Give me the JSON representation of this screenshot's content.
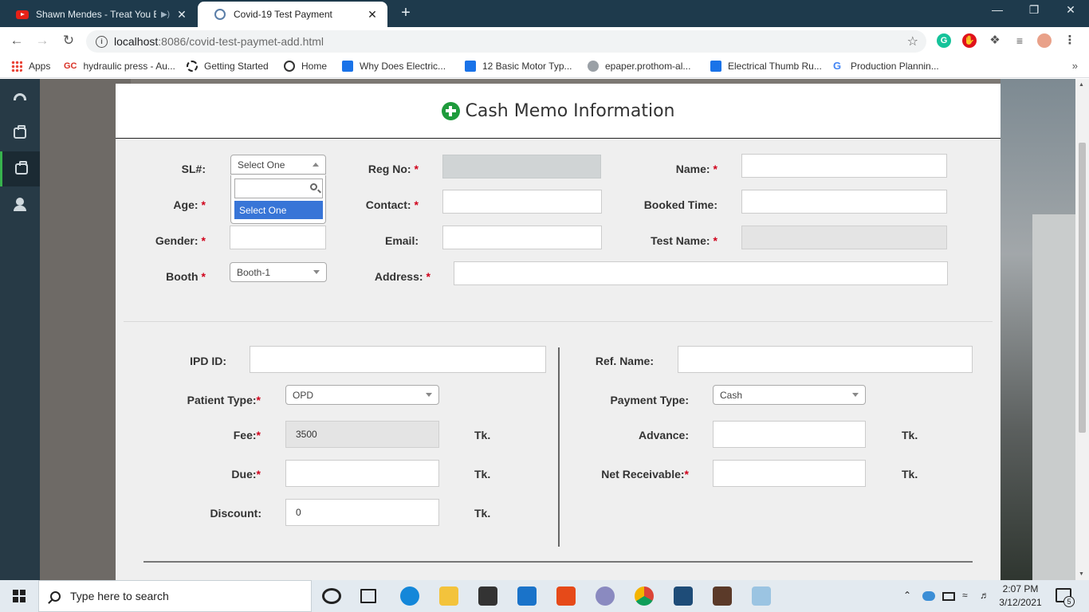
{
  "browser": {
    "tabs": [
      {
        "title": "Shawn Mendes - Treat You B",
        "active": false
      },
      {
        "title": "Covid-19 Test Payment",
        "active": true
      }
    ],
    "url_host": "localhost",
    "url_rest": ":8086/covid-test-paymet-add.html",
    "bookmarks": [
      "Apps",
      "hydraulic press - Au...",
      "Getting Started",
      "Home",
      "Why Does Electric...",
      "12 Basic Motor Typ...",
      "epaper.prothom-al...",
      "Electrical Thumb Ru...",
      "Production Plannin..."
    ],
    "bookmark_prefix_gc": "GC"
  },
  "sidebar": {
    "items": [
      {
        "icon": "dashboard-icon",
        "active": false
      },
      {
        "icon": "first-aid-kit-icon",
        "active": false
      },
      {
        "icon": "medical-bag-icon",
        "active": true
      },
      {
        "icon": "user-icon",
        "active": false
      }
    ]
  },
  "form": {
    "title": "Cash Memo Information",
    "section1": {
      "sl_label": "SL#:",
      "sl_value": "Select One",
      "sl_dropdown_option": "Select One",
      "regno_label": "Reg No:",
      "name_label": "Name:",
      "age_label": "Age:",
      "contact_label": "Contact:",
      "booked_time_label": "Booked Time:",
      "gender_label": "Gender:",
      "email_label": "Email:",
      "test_name_label": "Test Name:",
      "booth_label": "Booth",
      "booth_value": "Booth-1",
      "address_label": "Address:",
      "required_mark": "*"
    },
    "section2": {
      "ipd_label": "IPD ID:",
      "patient_type_label": "Patient Type:",
      "patient_type_value": "OPD",
      "fee_label": "Fee:",
      "fee_value": "3500",
      "due_label": "Due:",
      "discount_label": "Discount:",
      "discount_value": "0",
      "ref_name_label": "Ref. Name:",
      "payment_type_label": "Payment Type:",
      "payment_type_value": "Cash",
      "advance_label": "Advance:",
      "net_receivable_label": "Net Receivable:",
      "unit": "Tk."
    }
  },
  "taskbar": {
    "search_placeholder": "Type here to search",
    "time": "2:07 PM",
    "date": "3/12/2021",
    "notification_count": "5"
  },
  "colors": {
    "accent_green": "#1e9b3c",
    "sidebar_bg": "#273a46",
    "tabstrip_bg": "#1e3a4c",
    "required_red": "#d0021b",
    "dropdown_highlight": "#3875d7"
  }
}
